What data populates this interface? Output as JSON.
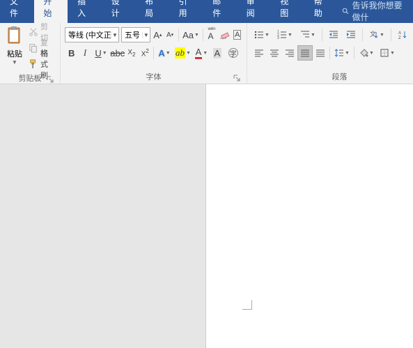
{
  "tabs": {
    "file": "文件",
    "home": "开始",
    "insert": "插入",
    "design": "设计",
    "layout": "布局",
    "references": "引用",
    "mail": "邮件",
    "review": "审阅",
    "view": "视图",
    "help": "帮助"
  },
  "tellme": "告诉我你想要做什",
  "clipboard": {
    "paste": "粘贴",
    "cut": "剪切",
    "copy": "复制",
    "format_painter": "格式刷",
    "group": "剪贴板"
  },
  "font": {
    "name": "等线 (中文正",
    "size": "五号",
    "group": "字体"
  },
  "paragraph": {
    "group": "段落"
  }
}
